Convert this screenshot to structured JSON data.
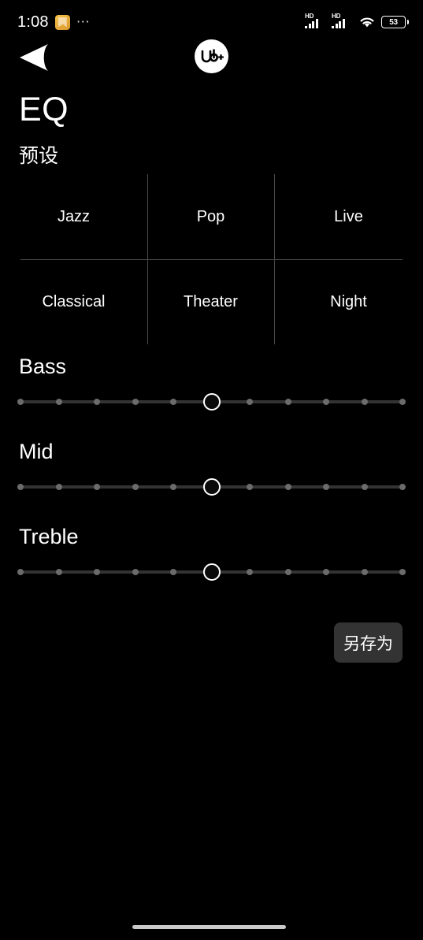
{
  "status_bar": {
    "time": "1:08",
    "app_icon": "notes-app-icon",
    "overflow_dots": "⋯",
    "signal_1_label": "HD",
    "signal_2_label": "HD",
    "wifi_icon": "wifi-icon",
    "battery_level": "53"
  },
  "nav": {
    "back_icon": "back-arrow-icon",
    "brand_logo": "ub-plus-logo"
  },
  "header": {
    "title": "EQ",
    "section_label": "预设"
  },
  "presets": {
    "items": [
      {
        "label": "Jazz"
      },
      {
        "label": "Pop"
      },
      {
        "label": "Live"
      },
      {
        "label": "Classical"
      },
      {
        "label": "Theater"
      },
      {
        "label": "Night"
      }
    ]
  },
  "sliders": [
    {
      "label": "Bass",
      "value": 5,
      "min": 0,
      "max": 10,
      "ticks": 11
    },
    {
      "label": "Mid",
      "value": 5,
      "min": 0,
      "max": 10,
      "ticks": 11
    },
    {
      "label": "Treble",
      "value": 5,
      "min": 0,
      "max": 10,
      "ticks": 11
    }
  ],
  "actions": {
    "save_as_label": "另存为"
  },
  "colors": {
    "background": "#000000",
    "text": "#ffffff",
    "divider": "#4a4a4a",
    "track": "#333333",
    "tick": "#6b6b6b",
    "button_bg": "#333333",
    "home_indicator": "#c9c9c9"
  }
}
